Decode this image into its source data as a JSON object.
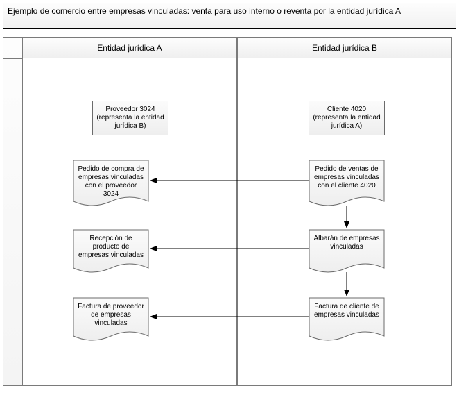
{
  "diagram": {
    "title": "Ejemplo de comercio entre empresas vinculadas: venta para uso interno o reventa por la entidad jurídica A",
    "columns": {
      "a": "Entidad jurídica A",
      "b": "Entidad jurídica B"
    },
    "nodes": {
      "vendor_a": "Proveedor 3024 (representa la entidad jurídica B)",
      "customer_b": "Cliente 4020 (representa la entidad jurídica A)",
      "po_a": "Pedido de compra de empresas vinculadas con el proveedor 3024",
      "so_b": "Pedido de ventas de empresas vinculadas con el cliente 4020",
      "receipt_a": "Recepción de producto de empresas vinculadas",
      "packingslip_b": "Albarán de empresas vinculadas",
      "vend_invoice_a": "Factura de proveedor de empresas vinculadas",
      "cust_invoice_b": "Factura de cliente de empresas vinculadas"
    }
  }
}
